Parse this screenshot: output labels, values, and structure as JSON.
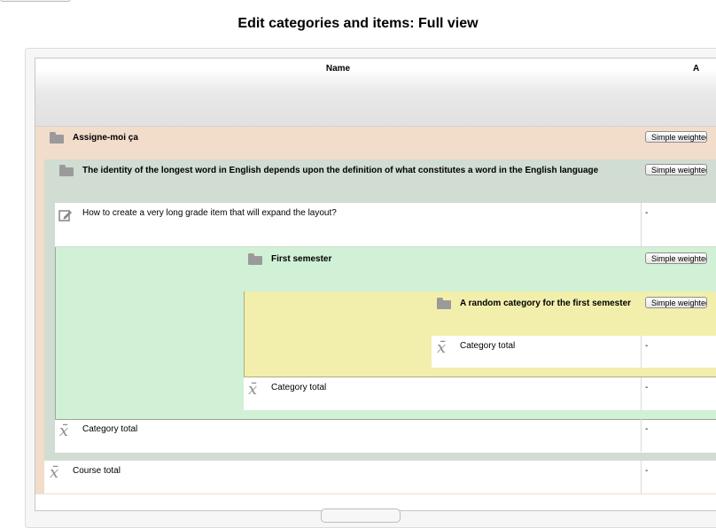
{
  "page_title": "Edit categories and items: Full view",
  "table": {
    "col_name": "Name",
    "col_second_partial": "A"
  },
  "rows": {
    "cat_assigne": {
      "label": "Assigne-moi ça",
      "button": "Simple weighted mean of grades"
    },
    "cat_identity": {
      "label": "The identity of the longest word in English depends upon the definition of what constitutes a word in the English language",
      "button": "Simple weighted mean of grades"
    },
    "item_long": {
      "label": "How to create a very long grade item that will expand the layout?",
      "value": "-"
    },
    "cat_first_semester": {
      "label": "First semester",
      "button": "Simple weighted mean of grades"
    },
    "cat_random": {
      "label": "A random category for the first semester",
      "button": "Simple weighted mean of grades"
    },
    "total_random": {
      "label": "Category total",
      "value": "-"
    },
    "total_first_semester": {
      "label": "Category total",
      "value": "-"
    },
    "total_identity": {
      "label": "Category total",
      "value": "-"
    },
    "course_total": {
      "label": "Course total",
      "value": "-"
    }
  },
  "icons": {
    "folder": "folder-icon",
    "edit": "edit-item-icon",
    "total": "x-bar-total-icon"
  },
  "colors": {
    "level1": "#f2dcca",
    "level2": "#d1dcd2",
    "level3": "#d0f1d6",
    "level4": "#f1efab"
  }
}
